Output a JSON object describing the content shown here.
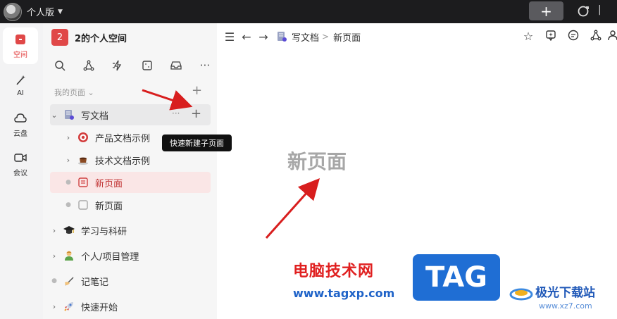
{
  "titlebar": {
    "edition": "个人版",
    "plus_label": "+"
  },
  "rail": [
    {
      "label": "空间",
      "icon": "space-icon",
      "active": true
    },
    {
      "label": "AI",
      "icon": "ai-wand-icon",
      "active": false
    },
    {
      "label": "云盘",
      "icon": "cloud-icon",
      "active": false
    },
    {
      "label": "会议",
      "icon": "video-icon",
      "active": false
    }
  ],
  "sidebar": {
    "space_badge": "2",
    "space_title": "2的个人空间",
    "section_label": "我的页面",
    "section_caret": "⌄",
    "tree": [
      {
        "label": "写文档",
        "icon": "doc-icon",
        "level": 0,
        "expanded": true,
        "more": "···",
        "add": "+"
      },
      {
        "label": "产品文档示例",
        "icon": "target-icon",
        "level": 1,
        "expanded": false
      },
      {
        "label": "技术文档示例",
        "icon": "coffee-icon",
        "level": 1,
        "expanded": false
      },
      {
        "label": "新页面",
        "icon": "page-icon",
        "level": 1,
        "selected": true
      },
      {
        "label": "新页面",
        "icon": "blank-page-icon",
        "level": 1
      },
      {
        "label": "学习与科研",
        "icon": "graduation-cap-icon",
        "level": 0,
        "expanded": false
      },
      {
        "label": "个人/项目管理",
        "icon": "person-icon",
        "level": 0,
        "expanded": false
      },
      {
        "label": "记笔记",
        "icon": "writing-hand-icon",
        "level": 0
      },
      {
        "label": "快速开始",
        "icon": "rocket-icon",
        "level": 0,
        "expanded": false
      }
    ],
    "tooltip": "快速新建子页面"
  },
  "breadcrumb": {
    "parent": "写文档",
    "separator": ">",
    "current": "新页面"
  },
  "page": {
    "title": "新页面"
  },
  "watermark": {
    "site_cn": "电脑技术网",
    "site_url": "www.tagxp.com",
    "tag": "TAG",
    "jg_cn": "极光下载站",
    "jg_url": "www.xz7.com"
  },
  "colors": {
    "accent": "#e04848",
    "selected_bg": "#fae6e6",
    "title_gray": "#a7a7a7"
  }
}
